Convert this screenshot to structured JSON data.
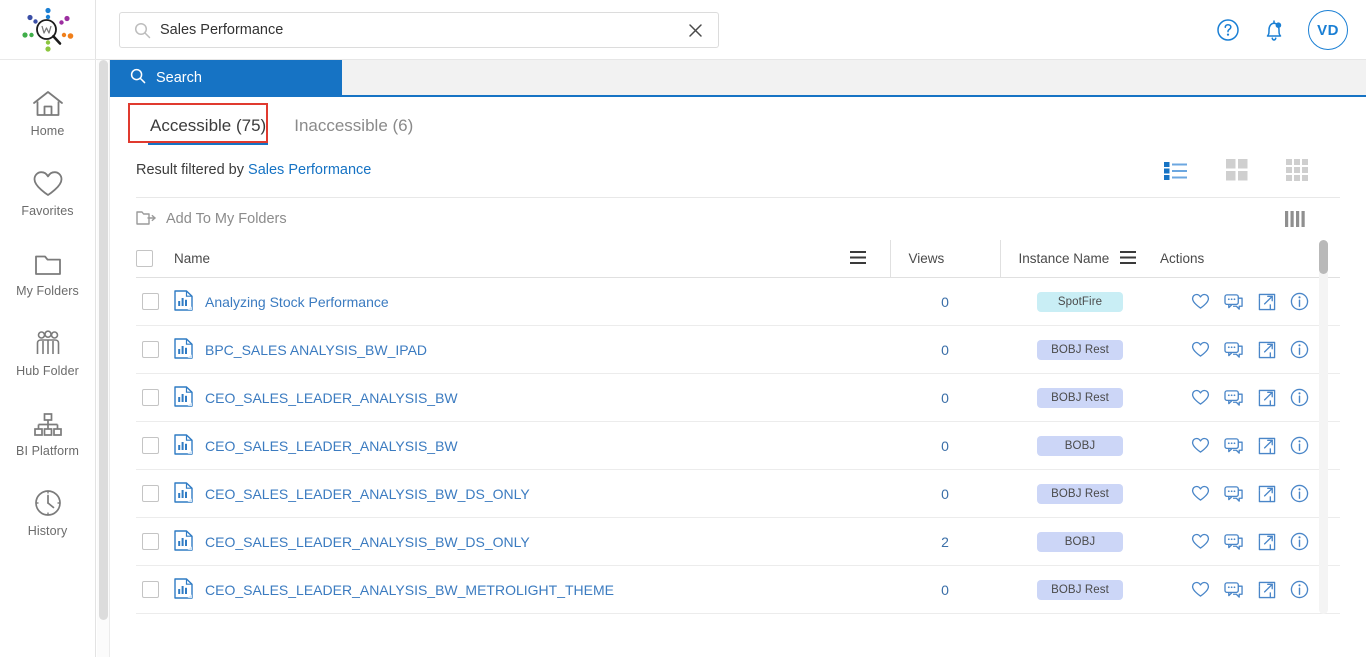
{
  "app": {
    "logo_name": "analytics-search-logo",
    "accent_blue": "#1673c4",
    "link_blue": "#3b7bc0",
    "highlight_red": "#e03a2f"
  },
  "sidebar": {
    "items": [
      {
        "label": "Home",
        "icon": "home-icon"
      },
      {
        "label": "Favorites",
        "icon": "heart-icon"
      },
      {
        "label": "My Folders",
        "icon": "folder-icon"
      },
      {
        "label": "Hub Folder",
        "icon": "people-group-icon"
      },
      {
        "label": "BI Platform",
        "icon": "org-chart-icon"
      },
      {
        "label": "History",
        "icon": "clock-icon"
      }
    ]
  },
  "topbar": {
    "search": {
      "value": "Sales Performance",
      "placeholder": "Search",
      "icon": "search-icon",
      "clear_icon": "close-icon"
    },
    "help_icon": "help-circle-icon",
    "notifications_icon": "bell-icon",
    "avatar_initials": "VD"
  },
  "search_tab": {
    "label": "Search",
    "icon": "search-icon"
  },
  "tabs": [
    {
      "label": "Accessible (75)",
      "active": true
    },
    {
      "label": "Inaccessible (6)",
      "active": false
    }
  ],
  "filter": {
    "prefix": "Result filtered by",
    "term": "Sales Performance"
  },
  "view_toggles": [
    {
      "name": "list-view-toggle",
      "active": true
    },
    {
      "name": "medium-grid-view-toggle",
      "active": false
    },
    {
      "name": "small-grid-view-toggle",
      "active": false
    }
  ],
  "actionbar": {
    "add_to_my_folders": "Add To My Folders",
    "add_icon": "folder-arrow-icon",
    "columns_icon": "columns-icon"
  },
  "table": {
    "columns": {
      "name": "Name",
      "views": "Views",
      "instance_name": "Instance Name",
      "actions": "Actions"
    },
    "row_icon": "report-document-icon",
    "action_icons": [
      "heart-icon",
      "comment-icon",
      "open-expand-icon",
      "info-icon"
    ],
    "rows": [
      {
        "name": "Analyzing Stock Performance",
        "views": "0",
        "instance": "SpotFire",
        "badge_style": "spotfire"
      },
      {
        "name": "BPC_SALES ANALYSIS_BW_IPAD",
        "views": "0",
        "instance": "BOBJ Rest",
        "badge_style": "bobj"
      },
      {
        "name": "CEO_SALES_LEADER_ANALYSIS_BW",
        "views": "0",
        "instance": "BOBJ Rest",
        "badge_style": "bobj"
      },
      {
        "name": "CEO_SALES_LEADER_ANALYSIS_BW",
        "views": "0",
        "instance": "BOBJ",
        "badge_style": "bobj"
      },
      {
        "name": "CEO_SALES_LEADER_ANALYSIS_BW_DS_ONLY",
        "views": "0",
        "instance": "BOBJ Rest",
        "badge_style": "bobj"
      },
      {
        "name": "CEO_SALES_LEADER_ANALYSIS_BW_DS_ONLY",
        "views": "2",
        "instance": "BOBJ",
        "badge_style": "bobj"
      },
      {
        "name": "CEO_SALES_LEADER_ANALYSIS_BW_METROLIGHT_THEME",
        "views": "0",
        "instance": "BOBJ Rest",
        "badge_style": "bobj"
      }
    ]
  }
}
